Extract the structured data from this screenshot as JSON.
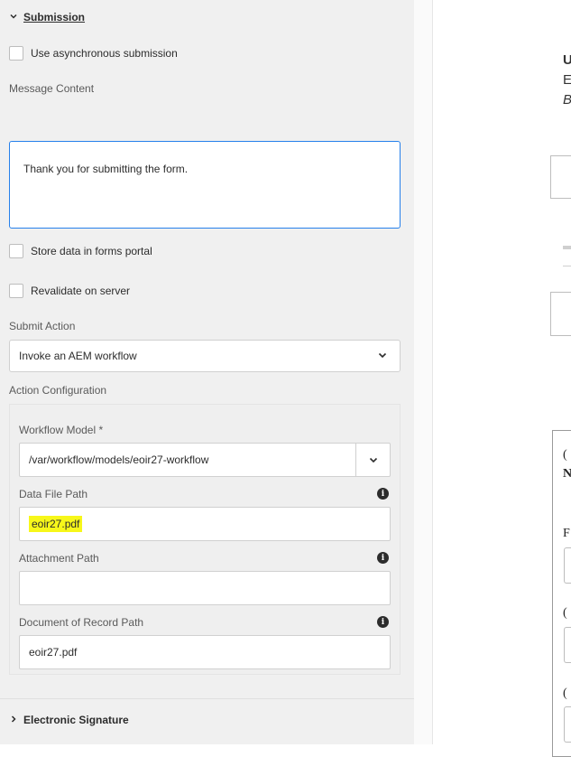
{
  "submission": {
    "title": "Submission",
    "async_label": "Use asynchronous submission",
    "message_content_label": "Message Content",
    "message_content_value": "Thank you for submitting the form.",
    "store_label": "Store data in forms portal",
    "revalidate_label": "Revalidate on server",
    "submit_action_label": "Submit Action",
    "submit_action_value": "Invoke an AEM workflow",
    "action_config_label": "Action Configuration"
  },
  "action_config": {
    "workflow_model_label": "Workflow Model *",
    "workflow_model_value": "/var/workflow/models/eoir27-workflow",
    "data_file_path_label": "Data File Path",
    "data_file_path_value": "eoir27.pdf",
    "attachment_path_label": "Attachment Path",
    "attachment_path_value": "",
    "dor_path_label": "Document of Record Path",
    "dor_path_value": "eoir27.pdf",
    "info_glyph": "i"
  },
  "electronic_signature": {
    "title": "Electronic Signature"
  },
  "preview": {
    "t1": "U",
    "t2": "E",
    "t3": "B",
    "t4": "(",
    "t5": "N",
    "t6": "F",
    "t7": "(",
    "t8": "("
  },
  "colors": {
    "panel_bg": "#f0f0f0",
    "focus_border": "#2680eb",
    "highlight": "#f7f71a"
  },
  "icons": [
    "chevron-down-icon",
    "chevron-right-icon",
    "info-icon"
  ]
}
